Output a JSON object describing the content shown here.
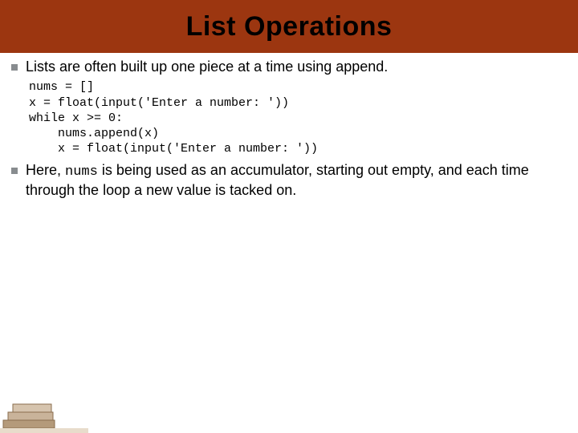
{
  "title": "List Operations",
  "bullets": {
    "b1": "Lists are often built up one piece at a time using append.",
    "b2_pre": "Here, ",
    "b2_code": "nums",
    "b2_post": " is being used as an accumulator, starting out empty, and each time through the loop a new value is tacked on."
  },
  "code": "nums = []\nx = float(input('Enter a number: '))\nwhile x >= 0:\n    nums.append(x)\n    x = float(input('Enter a number: '))"
}
